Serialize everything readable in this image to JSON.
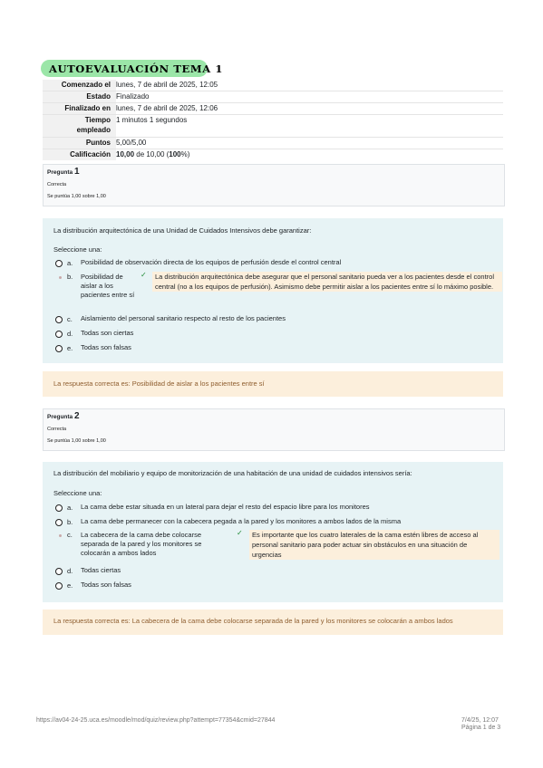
{
  "header": {
    "title": "AUTOEVALUACIÓN TEMA 1"
  },
  "summary": {
    "rows": [
      {
        "label": "Comenzado el",
        "value": "lunes, 7 de abril de 2025, 12:05"
      },
      {
        "label": "Estado",
        "value": "Finalizado"
      },
      {
        "label": "Finalizado en",
        "value": "lunes, 7 de abril de 2025, 12:06"
      },
      {
        "label": "Tiempo empleado",
        "value": "1 minutos 1 segundos"
      },
      {
        "label": "Puntos",
        "value": "5,00/5,00"
      },
      {
        "label": "Calificación",
        "value_bold": "10,00",
        "value_mid": " de 10,00 (",
        "value_pct": "100",
        "value_end": "%)"
      }
    ]
  },
  "questions": [
    {
      "label": "Pregunta",
      "number": "1",
      "status": "Correcta",
      "score": "Se puntúa 1,00 sobre 1,00",
      "text": "La distribución arquitectónica de una Unidad de Cuidados Intensivos debe garantizar:",
      "select": "Seleccione una:",
      "options": [
        {
          "letter": "a.",
          "text": "Posibilidad de observación directa de los equipos de perfusión desde el control central"
        },
        {
          "letter": "b.",
          "text": "Posibilidad de aislar a los pacientes entre sí"
        },
        {
          "letter": "c.",
          "text": "Aislamiento del personal sanitario respecto al resto de los pacientes"
        },
        {
          "letter": "d.",
          "text": "Todas son ciertas"
        },
        {
          "letter": "e.",
          "text": "Todas son falsas"
        }
      ],
      "feedback": "La distribución arquitectónica debe asegurar que el personal sanitario pueda ver a los pacientes desde el control central (no a los equipos de perfusión). Asimismo debe permitir aislar a los pacientes entre sí lo máximo posible.",
      "right_answer": "La respuesta correcta es: Posibilidad de aislar a los pacientes entre sí"
    },
    {
      "label": "Pregunta",
      "number": "2",
      "status": "Correcta",
      "score": "Se puntúa 1,00 sobre 1,00",
      "text": "La distribución del mobiliario y equipo de monitorización de una habitación de una unidad de cuidados intensivos sería:",
      "select": "Seleccione una:",
      "options": [
        {
          "letter": "a.",
          "text": "La cama debe estar situada en un lateral para dejar el resto del espacio libre para los monitores"
        },
        {
          "letter": "b.",
          "text": "La cama debe permanecer con la cabecera pegada a la pared y los monitores a ambos lados de la misma"
        },
        {
          "letter": "c.",
          "text": "La cabecera de la cama debe colocarse separada de la pared y los monitores se colocarán a ambos lados"
        },
        {
          "letter": "d.",
          "text": "Todas ciertas"
        },
        {
          "letter": "e.",
          "text": "Todas son falsas"
        }
      ],
      "feedback": "Es importante que los cuatro laterales de la cama estén libres de acceso al personal sanitario para poder actuar sin obstáculos en una situación de urgencias",
      "right_answer": "La respuesta correcta es: La cabecera de la cama debe colocarse separada de la pared y los monitores se colocarán a ambos lados"
    }
  ],
  "footer": {
    "url": "https://av04-24-25.uca.es/moodle/mod/quiz/review.php?attempt=77354&cmid=27844",
    "date": "7/4/25, 12:07",
    "page": "Página 1 de 3"
  },
  "colors": {
    "title_bg": "#9be6a8",
    "formulation_bg": "#e7f3f5",
    "feedback_bg": "#fcefdc",
    "check": "#1e8a35"
  }
}
